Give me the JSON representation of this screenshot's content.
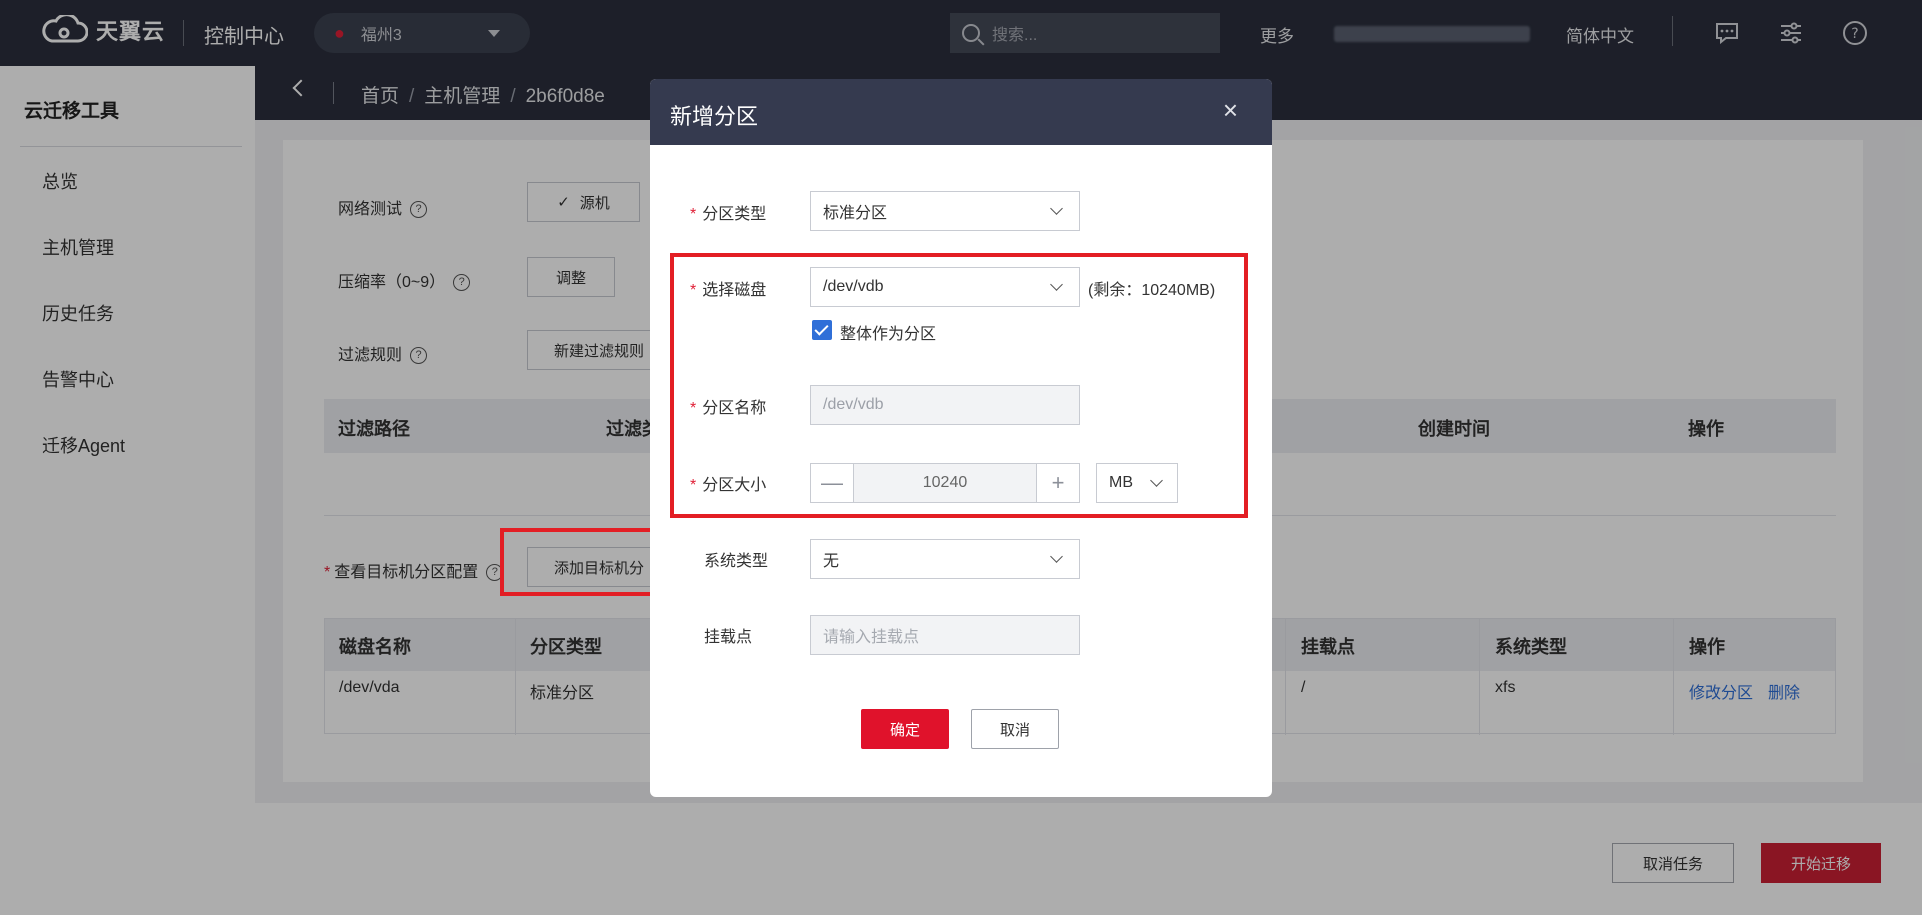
{
  "topbar": {
    "logo": "天翼云",
    "console": "控制中心",
    "region": "福州3",
    "search_placeholder": "搜索...",
    "more": "更多",
    "language": "简体中文"
  },
  "sidebar": {
    "title": "云迁移工具",
    "items": [
      "总览",
      "主机管理",
      "历史任务",
      "告警中心",
      "迁移Agent"
    ]
  },
  "breadcrumb": {
    "home": "首页",
    "host_mgmt": "主机管理",
    "host_id": "2b6f0d8e"
  },
  "settings": {
    "network_test": "网络测试",
    "network_btn": "源机",
    "compression": "压缩率（0~9）",
    "compression_btn": "调整",
    "filter_rule": "过滤规则",
    "filter_btn": "新建过滤规则",
    "filter_table_headers": [
      "过滤路径",
      "过滤类",
      "创建时间",
      "操作"
    ],
    "partition_cfg": "查看目标机分区配置",
    "add_partition_btn": "添加目标机分",
    "part_table_headers": [
      "磁盘名称",
      "分区类型",
      "挂载点",
      "系统类型",
      "操作"
    ],
    "part_row": {
      "disk": "/dev/vda",
      "type": "标准分区",
      "mount": "/",
      "fs": "xfs",
      "edit": "修改分区",
      "delete": "删除"
    }
  },
  "footer": {
    "cancel_task": "取消任务",
    "start_migrate": "开始迁移"
  },
  "modal": {
    "title": "新增分区",
    "close": "×",
    "partition_type_label": "分区类型",
    "partition_type_value": "标准分区",
    "select_disk_label": "选择磁盘",
    "select_disk_value": "/dev/vdb",
    "remaining": "(剩余：10240MB)",
    "whole_as_partition": "整体作为分区",
    "partition_name_label": "分区名称",
    "partition_name_value": "/dev/vdb",
    "partition_size_label": "分区大小",
    "partition_size_value": "10240",
    "size_unit": "MB",
    "fs_type_label": "系统类型",
    "fs_type_value": "无",
    "mount_label": "挂载点",
    "mount_placeholder": "请输入挂载点",
    "confirm": "确定",
    "cancel": "取消",
    "minus": "—",
    "plus": "+"
  },
  "colors": {
    "topbar": "#2b2f3d",
    "brand_red": "#e02037",
    "annotation_red": "#e31e24",
    "link_blue": "#2f6fd8"
  }
}
